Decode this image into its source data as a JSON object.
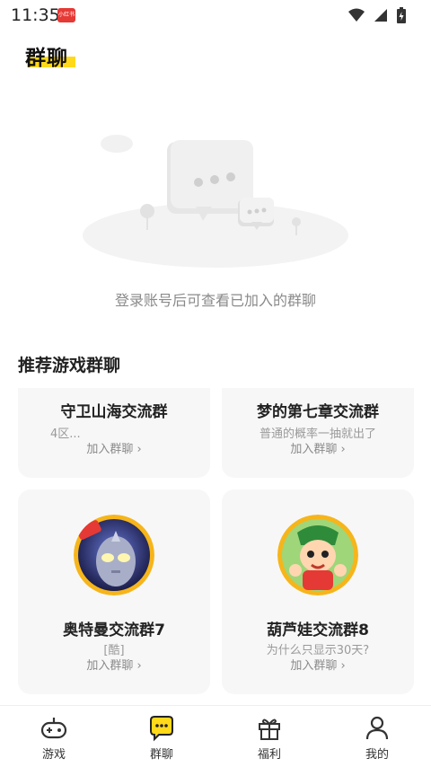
{
  "status_bar": {
    "time": "11:35",
    "app_badge": "小红书"
  },
  "header": {
    "title": "群聊"
  },
  "empty_state": {
    "message": "登录账号后可查看已加入的群聊"
  },
  "recommend": {
    "title": "推荐游戏群聊",
    "groups": [
      {
        "name": "守卫山海交流群",
        "desc": "4区...",
        "join_label": "加入群聊 ›"
      },
      {
        "name": "梦的第七章交流群",
        "desc": "普通的概率一抽就出了",
        "join_label": "加入群聊 ›"
      },
      {
        "name": "奥特曼交流群7",
        "desc": "[酷]",
        "join_label": "加入群聊 ›"
      },
      {
        "name": "葫芦娃交流群8",
        "desc": "为什么只显示30天?",
        "join_label": "加入群聊 ›"
      }
    ]
  },
  "bottom_nav": {
    "items": [
      {
        "label": "游戏",
        "icon": "gamepad-icon"
      },
      {
        "label": "群聊",
        "icon": "chat-bubble-icon",
        "active": true
      },
      {
        "label": "福利",
        "icon": "gift-icon"
      },
      {
        "label": "我的",
        "icon": "person-icon"
      }
    ]
  },
  "colors": {
    "accent": "#ffd91a",
    "card_bg": "#f7f7f7",
    "muted_text": "#8a8a8a"
  }
}
